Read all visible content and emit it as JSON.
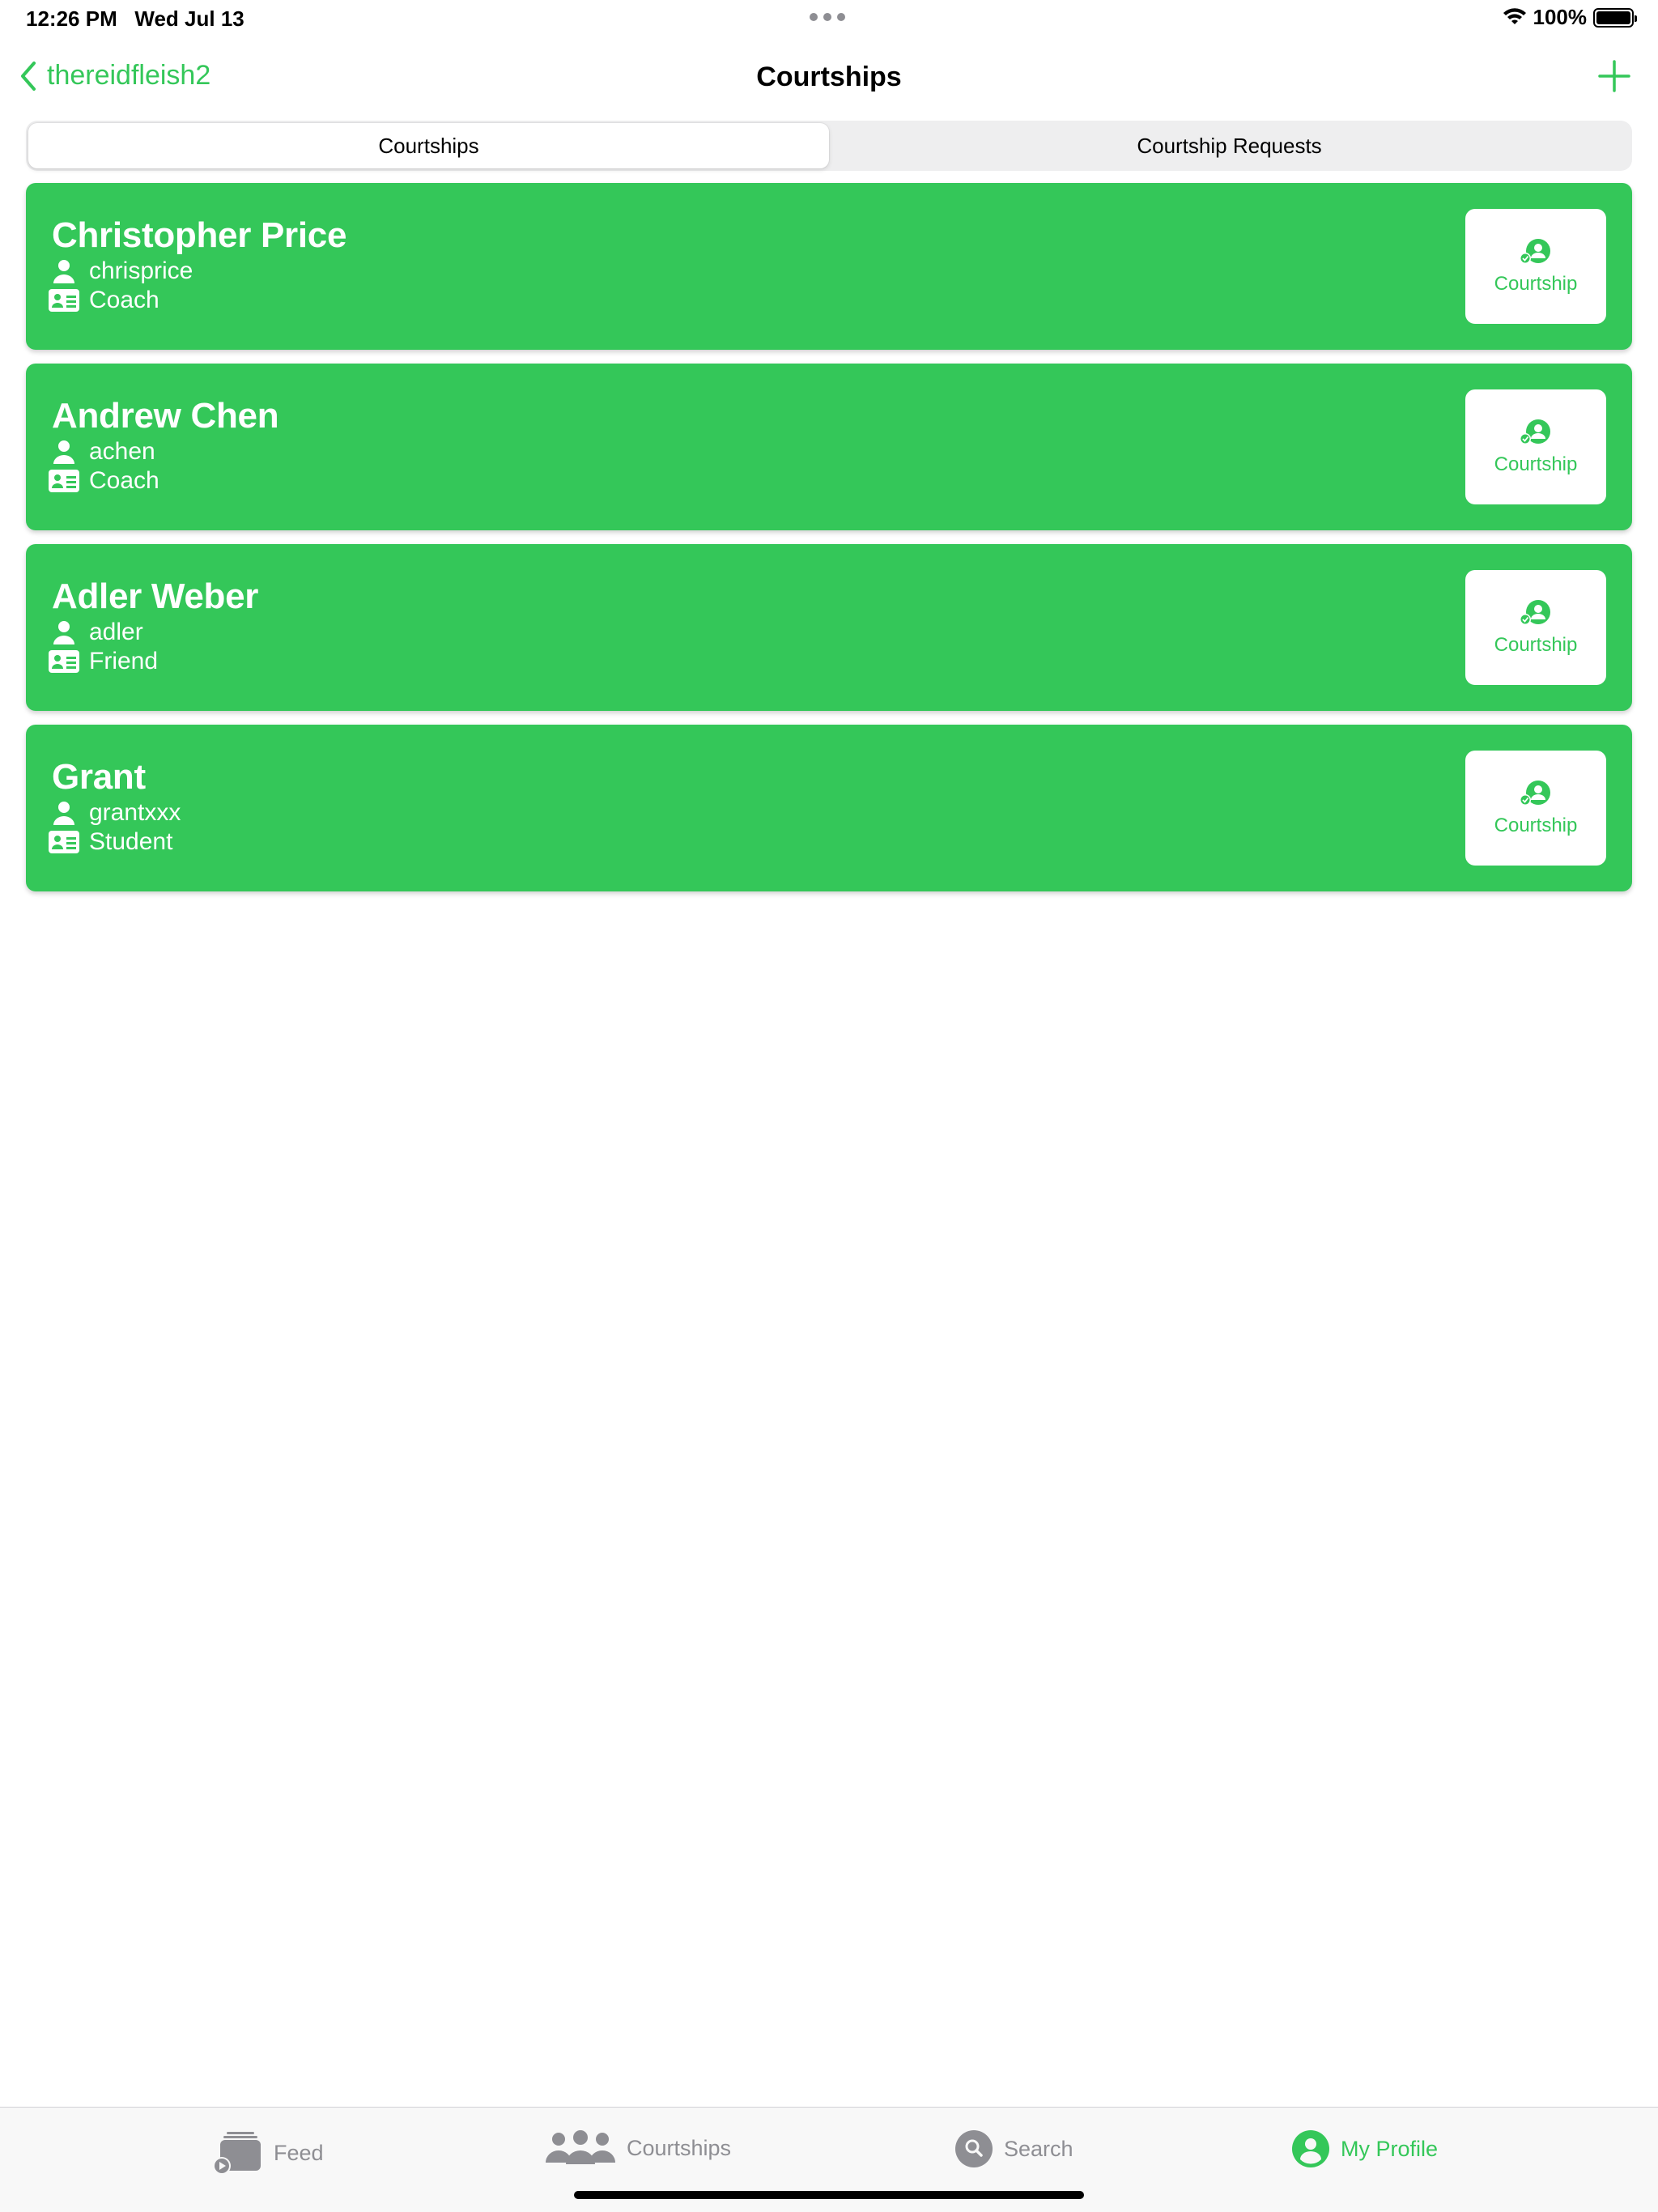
{
  "status_bar": {
    "time": "12:26 PM   Wed Jul 13",
    "battery_percent": "100%"
  },
  "nav": {
    "back_label": "thereidfleish2",
    "title": "Courtships"
  },
  "segments": [
    {
      "label": "Courtships",
      "selected": true
    },
    {
      "label": "Courtship Requests",
      "selected": false
    }
  ],
  "courtships": [
    {
      "name": "Christopher Price",
      "username": "chrisprice",
      "role": "Coach",
      "button_label": "Courtship"
    },
    {
      "name": "Andrew Chen",
      "username": "achen",
      "role": "Coach",
      "button_label": "Courtship"
    },
    {
      "name": "Adler Weber",
      "username": "adler",
      "role": "Friend",
      "button_label": "Courtship"
    },
    {
      "name": "Grant",
      "username": "grantxxx",
      "role": "Student",
      "button_label": "Courtship"
    }
  ],
  "tabs": [
    {
      "label": "Feed",
      "icon": "feed-icon",
      "active": false
    },
    {
      "label": "Courtships",
      "icon": "people-icon",
      "active": false
    },
    {
      "label": "Search",
      "icon": "search-icon",
      "active": false
    },
    {
      "label": "My Profile",
      "icon": "profile-icon",
      "active": true
    }
  ],
  "colors": {
    "accent": "#34c759",
    "inactive": "#8e8e93"
  }
}
